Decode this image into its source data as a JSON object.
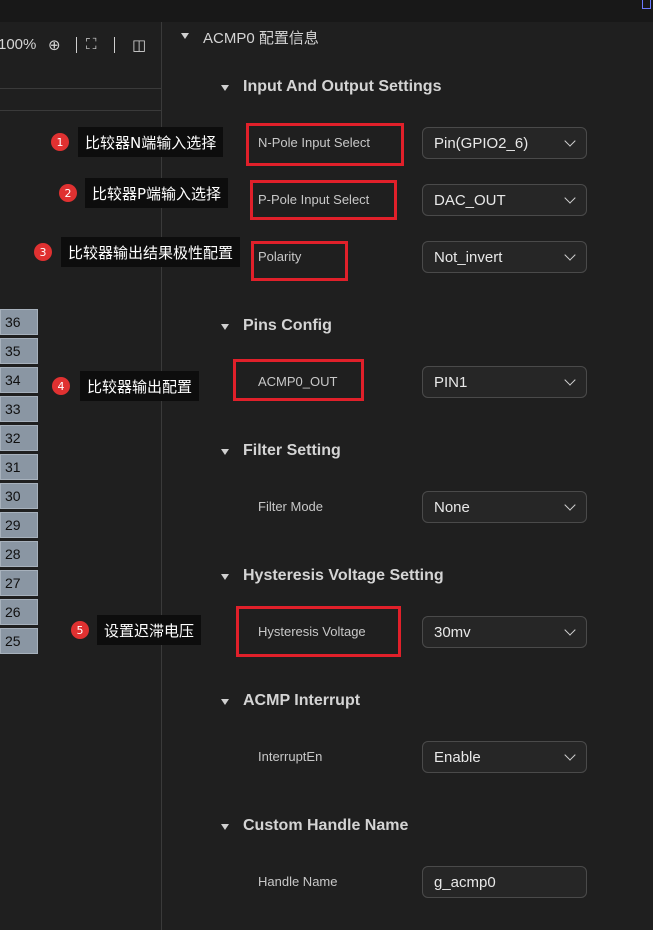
{
  "toolbar": {
    "zoom": "100%"
  },
  "pins": [
    "36",
    "35",
    "34",
    "33",
    "32",
    "31",
    "30",
    "29",
    "28",
    "27",
    "26",
    "25"
  ],
  "annotations": [
    {
      "num": "1",
      "text": "比较器N端输入选择"
    },
    {
      "num": "2",
      "text": "比较器P端输入选择"
    },
    {
      "num": "3",
      "text": "比较器输出结果极性配置"
    },
    {
      "num": "4",
      "text": "比较器输出配置"
    },
    {
      "num": "5",
      "text": "设置迟滞电压"
    }
  ],
  "config": {
    "title": "ACMP0 配置信息",
    "sections": {
      "io": "Input And Output Settings",
      "pins": "Pins Config",
      "filter": "Filter Setting",
      "hyst": "Hysteresis Voltage Setting",
      "interrupt": "ACMP Interrupt",
      "handle": "Custom Handle Name"
    },
    "fields": {
      "npole": {
        "label": "N-Pole Input Select",
        "value": "Pin(GPIO2_6)"
      },
      "ppole": {
        "label": "P-Pole Input Select",
        "value": "DAC_OUT"
      },
      "polarity": {
        "label": "Polarity",
        "value": "Not_invert"
      },
      "acmp_out": {
        "label": "ACMP0_OUT",
        "value": "PIN1"
      },
      "filter_mode": {
        "label": "Filter Mode",
        "value": "None"
      },
      "hyst_voltage": {
        "label": "Hysteresis Voltage",
        "value": "30mv"
      },
      "interrupt_en": {
        "label": "InterruptEn",
        "value": "Enable"
      },
      "handle_name": {
        "label": "Handle Name",
        "value": "g_acmp0"
      }
    }
  },
  "colors": {
    "highlight": "#e0202a",
    "badge": "#e03131",
    "pin": "#8a96a3"
  }
}
